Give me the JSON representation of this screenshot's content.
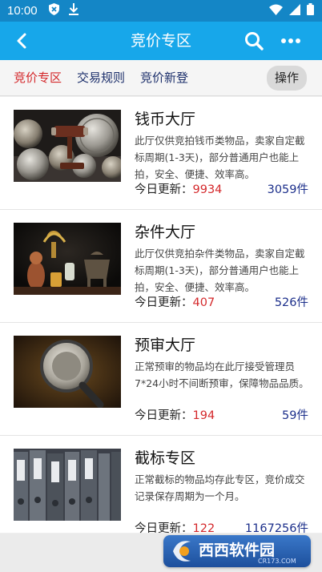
{
  "status_bar": {
    "time": "10:00",
    "icons": [
      "shield-x-icon",
      "download-icon",
      "wifi-icon",
      "signal-icon",
      "battery-icon"
    ]
  },
  "app_bar": {
    "title": "竞价专区",
    "icons": [
      "back-icon",
      "search-icon",
      "more-icon"
    ]
  },
  "tabs": [
    {
      "label": "竞价专区",
      "active": true
    },
    {
      "label": "交易规则",
      "active": false
    },
    {
      "label": "竞价新登",
      "active": false
    }
  ],
  "action_button": "操作",
  "halls": [
    {
      "name": "钱币大厅",
      "description": "此厅仅供竞拍钱币类物品，卖家自定截标周期(1-3天)，部分普通用户也能上拍，安全、便捷、效率高。",
      "update_label": "今日更新：",
      "update_count": "9934",
      "total": "3059件",
      "thumb": "coins-gavel"
    },
    {
      "name": "杂件大厅",
      "description": "此厅仅供竞拍杂件类物品，卖家自定截标周期(1-3天)，部分普通用户也能上拍，安全、便捷、效率高。",
      "update_label": "今日更新：",
      "update_count": "407",
      "total": "526件",
      "thumb": "antiques"
    },
    {
      "name": "预审大厅",
      "description": "正常预审的物品均在此厅接受管理员7*24小时不间断预审，保障物品品质。",
      "update_label": "今日更新：",
      "update_count": "194",
      "total": "59件",
      "thumb": "magnifier-coin"
    },
    {
      "name": "截标专区",
      "description": "正常截标的物品均存此专区，竞价成交记录保存周期为一个月。",
      "update_label": "今日更新：",
      "update_count": "122",
      "total": "1167256件",
      "thumb": "binders"
    }
  ],
  "watermark": {
    "brand": "西西软件园",
    "url": "CR173.COM"
  }
}
